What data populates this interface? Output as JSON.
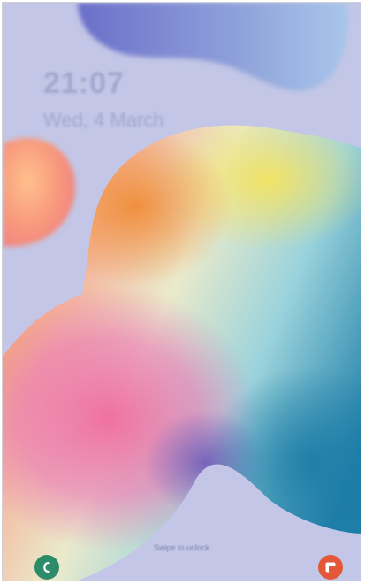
{
  "lockscreen": {
    "time": "21:07",
    "date": "Wed, 4 March",
    "unlock_hint": "Swipe to unlock"
  },
  "shortcuts": {
    "left": {
      "icon": "phone-icon",
      "color": "#2d8b69"
    },
    "right": {
      "icon": "camera-icon",
      "color": "#e4583a"
    }
  },
  "colors": {
    "background": "#c3c6e6",
    "text": "#a2a8cf"
  }
}
